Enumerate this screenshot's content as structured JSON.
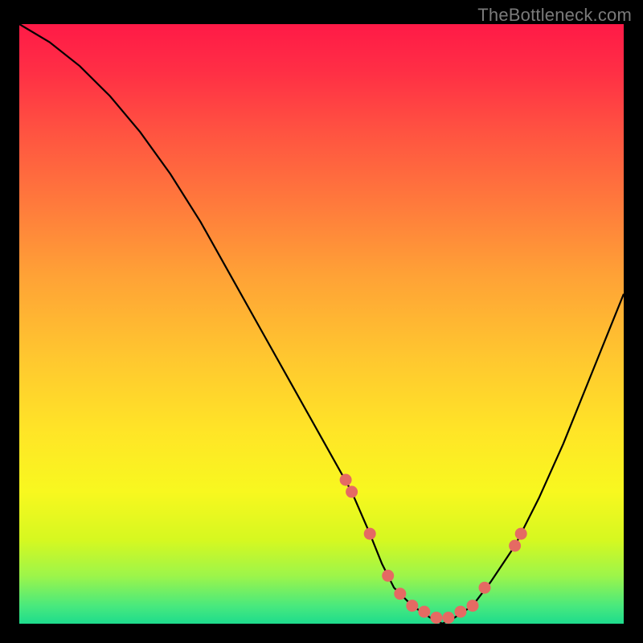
{
  "watermark": "TheBottleneck.com",
  "colors": {
    "page_bg": "#000000",
    "curve_stroke": "#000000",
    "marker_fill": "#e56a63",
    "gradient_top": "#ff1a47",
    "gradient_mid": "#ffe527",
    "gradient_bottom": "#1edc8d"
  },
  "chart_data": {
    "type": "line",
    "title": "",
    "xlabel": "",
    "ylabel": "",
    "xlim": [
      0,
      100
    ],
    "ylim": [
      0,
      100
    ],
    "series": [
      {
        "name": "bottleneck-curve",
        "x": [
          0,
          5,
          10,
          15,
          20,
          25,
          30,
          35,
          40,
          45,
          50,
          55,
          58,
          60,
          62,
          65,
          68,
          70,
          72,
          75,
          78,
          82,
          86,
          90,
          94,
          100
        ],
        "y": [
          100,
          97,
          93,
          88,
          82,
          75,
          67,
          58,
          49,
          40,
          31,
          22,
          15,
          10,
          6,
          3,
          1,
          0,
          1,
          3,
          7,
          13,
          21,
          30,
          40,
          55
        ]
      }
    ],
    "markers": {
      "name": "highlighted-points",
      "x": [
        54,
        55,
        58,
        61,
        63,
        65,
        67,
        69,
        71,
        73,
        75,
        77,
        82,
        83
      ],
      "y": [
        24,
        22,
        15,
        8,
        5,
        3,
        2,
        1,
        1,
        2,
        3,
        6,
        13,
        15
      ]
    }
  }
}
